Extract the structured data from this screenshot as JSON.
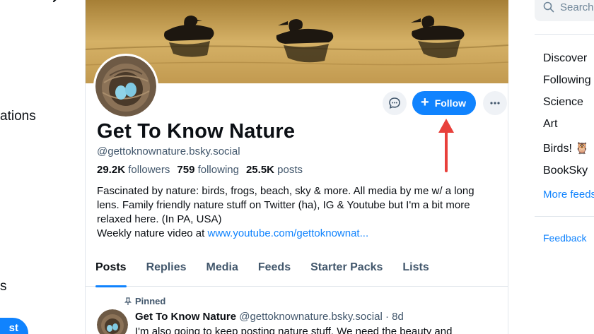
{
  "left_nav": {
    "notifications_fragment": "ations",
    "lists_fragment": "s",
    "post_button_fragment": "st"
  },
  "profile": {
    "display_name": "Get To Know Nature",
    "handle": "@gettoknownature.bsky.social",
    "followers_count": "29.2K",
    "followers_label": "followers",
    "following_count": "759",
    "following_label": "following",
    "posts_count": "25.5K",
    "posts_label": "posts",
    "bio_lines": [
      "Fascinated by nature: birds, frogs, beach, sky & more. All media by me w/ a long",
      "lens. Family friendly nature stuff on Twitter (ha), IG & Youtube but I'm a bit more",
      "relaxed here. (In PA, USA)"
    ],
    "bio_video_prefix": "Weekly nature video at ",
    "bio_link": "www.youtube.com/gettoknownat...",
    "follow_label": "Follow"
  },
  "tabs": [
    "Posts",
    "Replies",
    "Media",
    "Feeds",
    "Starter Packs",
    "Lists"
  ],
  "pinned_post": {
    "pinned_label": "Pinned",
    "author": "Get To Know Nature",
    "meta": "@gettoknownature.bsky.social · 8d",
    "text": "I'm also going to keep posting nature stuff. We need the beauty and"
  },
  "right_sidebar": {
    "search_placeholder": "Search",
    "feeds": [
      "Discover",
      "Following",
      "Science",
      "Art",
      "Birds! 🦉",
      "BookSky"
    ],
    "more_feeds": "More feeds",
    "feedback": "Feedback"
  },
  "colors": {
    "accent": "#1083fe",
    "annotation_arrow": "#e8403b",
    "muted_text": "#42576c"
  }
}
